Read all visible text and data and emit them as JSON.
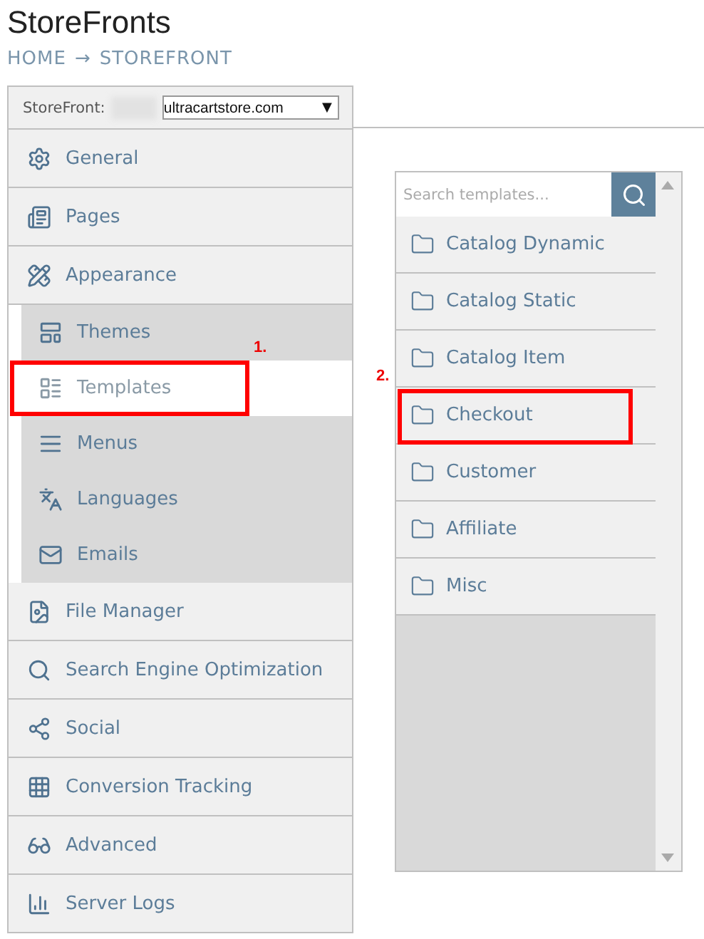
{
  "page": {
    "title": "StoreFronts",
    "breadcrumb": [
      "HOME",
      "→",
      "STOREFRONT"
    ]
  },
  "storefront_selector": {
    "label": "StoreFront:",
    "value": "ultracartstore.com",
    "caret": "▼"
  },
  "sidebar": {
    "items": [
      {
        "label": "General",
        "selected": false
      },
      {
        "label": "Pages",
        "selected": false
      },
      {
        "label": "Appearance",
        "selected": false,
        "expanded": true,
        "children": [
          {
            "label": "Themes",
            "selected": false
          },
          {
            "label": "Templates",
            "selected": true,
            "annotation": "1."
          },
          {
            "label": "Menus",
            "selected": false
          },
          {
            "label": "Languages",
            "selected": false
          },
          {
            "label": "Emails",
            "selected": false
          }
        ]
      },
      {
        "label": "File Manager",
        "selected": false
      },
      {
        "label": "Search Engine Optimization",
        "selected": false
      },
      {
        "label": "Social",
        "selected": false
      },
      {
        "label": "Conversion Tracking",
        "selected": false
      },
      {
        "label": "Advanced",
        "selected": false
      },
      {
        "label": "Server Logs",
        "selected": false
      }
    ]
  },
  "templates": {
    "search": {
      "placeholder": "Search templates..."
    },
    "items": [
      {
        "label": "Catalog Dynamic"
      },
      {
        "label": "Catalog Static"
      },
      {
        "label": "Catalog Item"
      },
      {
        "label": "Checkout",
        "annotation": "2."
      },
      {
        "label": "Customer"
      },
      {
        "label": "Affiliate"
      },
      {
        "label": "Misc"
      }
    ]
  }
}
